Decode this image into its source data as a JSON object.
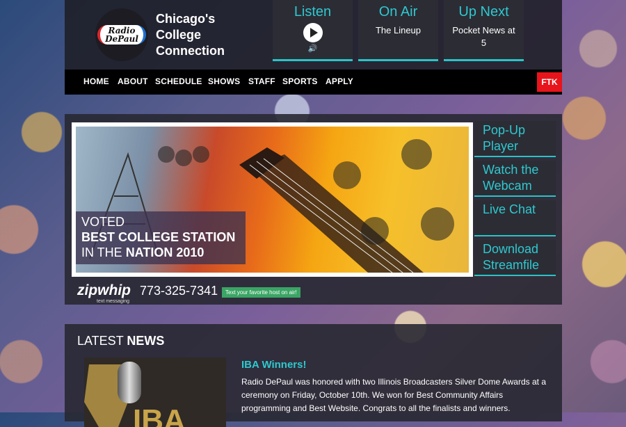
{
  "header": {
    "logo_line1": "Radio",
    "logo_line2": "DePaul",
    "tagline_line1": "Chicago's",
    "tagline_line2": "College",
    "tagline_line3": "Connection"
  },
  "tiles": {
    "listen": {
      "title": "Listen"
    },
    "on_air": {
      "title": "On Air",
      "subtitle": "The Lineup"
    },
    "up_next": {
      "title": "Up Next",
      "subtitle_line1": "Pocket News at",
      "subtitle_line2": "5"
    }
  },
  "nav": {
    "items": [
      "HOME",
      "ABOUT",
      "SCHEDULE",
      "SHOWS",
      "STAFF",
      "SPORTS",
      "APPLY"
    ],
    "ftk": "FTK"
  },
  "hero": {
    "line1": "VOTED",
    "line2": "BEST COLLEGE STATION",
    "line3_pre": "IN THE ",
    "line3_bold": "NATION 2010"
  },
  "zipwhip": {
    "brand": "zipwhip",
    "small": "text messaging",
    "phone": "773-325-7341",
    "button": "Text your favorite host on air!"
  },
  "side_links": {
    "popup": {
      "line1": "Pop-Up",
      "line2": "Player"
    },
    "webcam": {
      "line1": "Watch the",
      "line2": "Webcam"
    },
    "chat": {
      "line1": "Live Chat"
    },
    "download": {
      "line1": "Download",
      "line2": "Streamfile"
    }
  },
  "news": {
    "title_pre": "LATEST ",
    "title_bold": "NEWS",
    "image_text": "IBA",
    "headline": "IBA Winners!",
    "body": "Radio DePaul was honored with two Illinois Broadcasters Silver Dome Awards at a ceremony on Friday, October 10th. We won for Best Community Affairs programming and Best Website. Congrats to all the finalists and winners."
  }
}
